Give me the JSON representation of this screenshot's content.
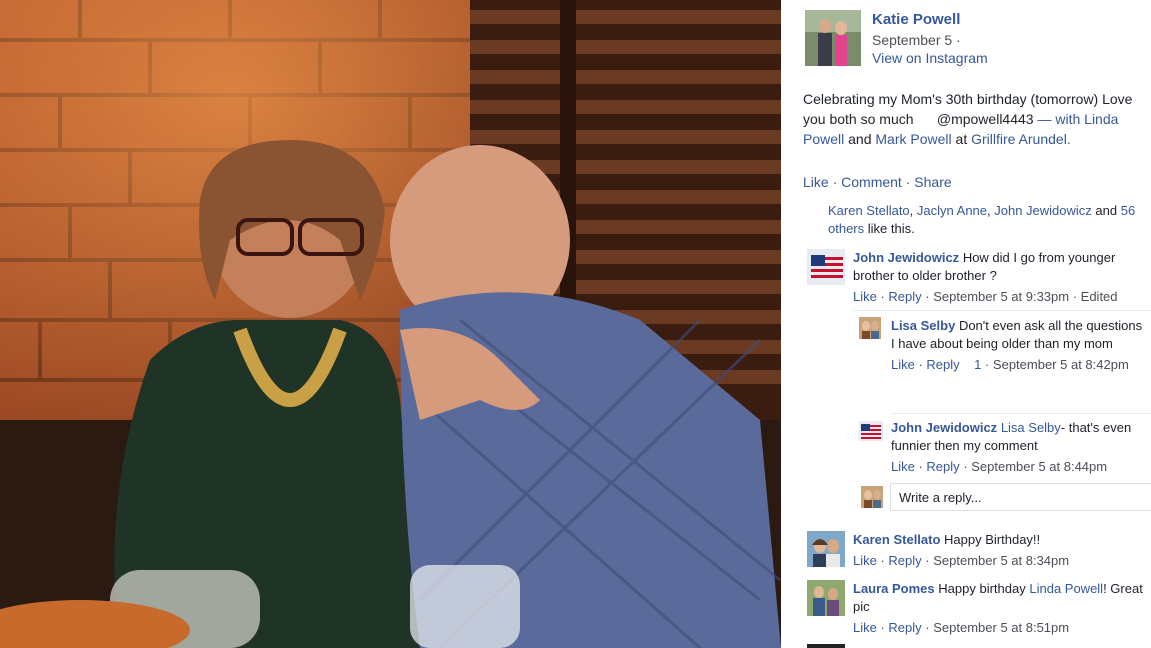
{
  "post": {
    "author": "Katie Powell",
    "date": "September 5 ·",
    "via": "View on Instagram",
    "caption_pre": "Celebrating my Mom's 30th birthday (tomorrow) Love you both so much",
    "caption_handle": "@mpowell4443",
    "caption_with": "— with",
    "tag_1": "Linda Powell",
    "caption_and": "and",
    "tag_2": "Mark Powell",
    "caption_at": "at",
    "place": "Grillfire Arundel."
  },
  "actions": {
    "like": "Like",
    "comment": "Comment",
    "share": "Share",
    "sep": "·"
  },
  "likes": {
    "name_1": "Karen Stellato",
    "name_2": "Jaclyn Anne",
    "name_3": "John Jewidowicz",
    "and": "and",
    "others": "56 others",
    "suffix": "like this."
  },
  "comments": [
    {
      "author": "John Jewidowicz",
      "text": "How did I go from younger brother to older brother ?",
      "like": "Like",
      "reply": "Reply",
      "meta": "· September 5 at 9:33pm · Edited"
    },
    {
      "author": "Lisa Selby",
      "text": "Don't even ask all the questions I have about being older than my mom",
      "like": "Like",
      "reply": "Reply",
      "count": "1",
      "meta": "· September 5 at 8:42pm"
    },
    {
      "author": "John Jewidowicz",
      "mention": "Lisa Selby",
      "text": "- that's even funnier then my comment",
      "like": "Like",
      "reply": "Reply",
      "meta": "· September 5 at 8:44pm"
    },
    {
      "author": "Karen Stellato",
      "text": "Happy Birthday!!",
      "like": "Like",
      "reply": "Reply",
      "meta": "· September 5 at 8:34pm"
    },
    {
      "author": "Laura Pomes",
      "text_pre": "Happy birthday",
      "mention": "Linda Powell",
      "text_post": "! Great pic",
      "like": "Like",
      "reply": "Reply",
      "meta": "· September 5 at 8:51pm"
    }
  ],
  "reply_box": {
    "placeholder": "Write a reply..."
  },
  "colors": {
    "link": "#365899",
    "text": "#1d2129",
    "meta": "#4b4f56"
  }
}
